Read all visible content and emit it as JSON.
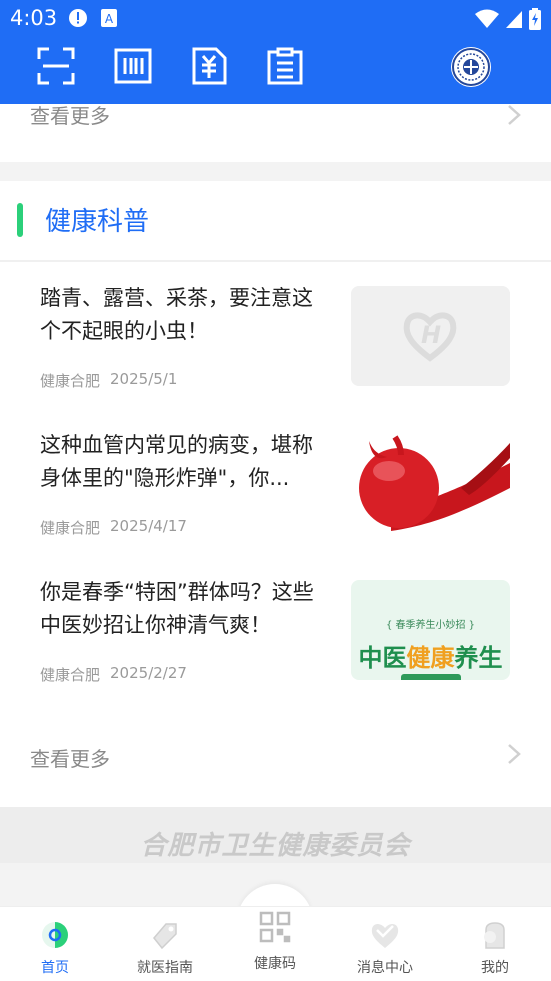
{
  "status_bar": {
    "time": "4:03",
    "icons": [
      "alert-icon",
      "accessibility-icon",
      "wifi-icon",
      "signal-icon",
      "battery-icon"
    ]
  },
  "toolbar": {
    "buttons": [
      "scan-icon",
      "barcode-icon",
      "payment-icon",
      "clipboard-icon"
    ],
    "logo": "hospital-logo"
  },
  "top_card": {
    "more_label": "查看更多"
  },
  "health_section": {
    "title": "健康科普",
    "articles": [
      {
        "title": "踏青、露营、采茶，要注意这个不起眼的小虫！",
        "source": "健康合肥",
        "date": "2025/5/1",
        "thumb": "placeholder-logo"
      },
      {
        "title": "这种血管内常见的病变，堪称身体里的\"隐形炸弹\"，你...",
        "source": "健康合肥",
        "date": "2025/4/17",
        "thumb": "artery-illustration"
      },
      {
        "title": "你是春季“特困”群体吗？这些中医妙招让你神清气爽！",
        "source": "健康合肥",
        "date": "2025/2/27",
        "thumb": "tcm-banner",
        "thumb_small": "{ 春季养生小妙招 }",
        "thumb_big_1": "中医",
        "thumb_big_2": "健康",
        "thumb_big_3": "养生"
      }
    ],
    "more_label": "查看更多"
  },
  "footer": {
    "text": "合肥市卫生健康委员会"
  },
  "tabbar": {
    "tabs": [
      {
        "label": "首页",
        "icon": "home-icon",
        "active": true
      },
      {
        "label": "就医指南",
        "icon": "guide-icon",
        "active": false
      },
      {
        "label": "健康码",
        "icon": "qr-code-icon",
        "active": false
      },
      {
        "label": "消息中心",
        "icon": "heart-message-icon",
        "active": false
      },
      {
        "label": "我的",
        "icon": "profile-icon",
        "active": false
      }
    ]
  },
  "colors": {
    "primary": "#1f6df5",
    "accent_green": "#2bd07a"
  }
}
